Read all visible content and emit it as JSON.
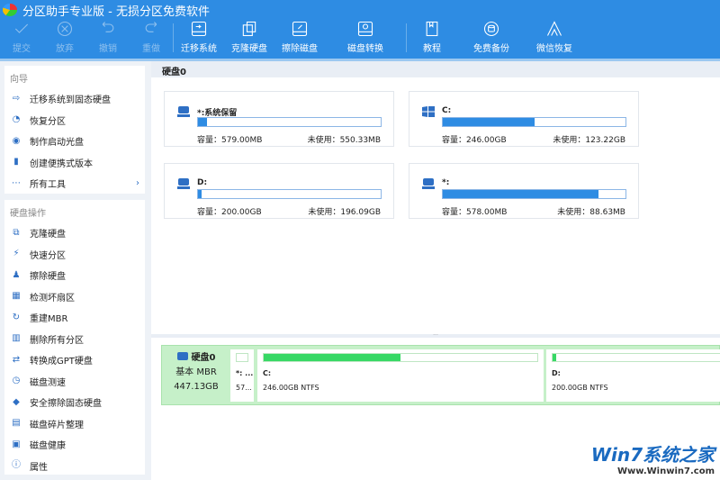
{
  "title": "分区助手专业版 - 无损分区免费软件",
  "toolbar": [
    {
      "label": "提交",
      "icon": "check-icon",
      "disabled": true
    },
    {
      "label": "放弃",
      "icon": "cancel-circle-icon",
      "disabled": true
    },
    {
      "label": "撤销",
      "icon": "undo-icon",
      "disabled": true
    },
    {
      "label": "重做",
      "icon": "redo-icon",
      "disabled": true
    },
    {
      "label": "迁移系统",
      "icon": "migrate-disk-icon"
    },
    {
      "label": "克隆硬盘",
      "icon": "clone-disk-icon"
    },
    {
      "label": "擦除磁盘",
      "icon": "wipe-disk-icon"
    },
    {
      "label": "磁盘转换",
      "icon": "convert-disk-icon"
    },
    {
      "label": "教程",
      "icon": "book-icon"
    },
    {
      "label": "免费备份",
      "icon": "backup-icon"
    },
    {
      "label": "微信恢复",
      "icon": "recover-icon"
    }
  ],
  "sidebar": {
    "wizard_title": "向导",
    "wizard": [
      {
        "label": "迁移系统到固态硬盘"
      },
      {
        "label": "恢复分区"
      },
      {
        "label": "制作启动光盘"
      },
      {
        "label": "创建便携式版本"
      },
      {
        "label": "所有工具"
      }
    ],
    "ops_title": "硬盘操作",
    "ops": [
      {
        "label": "克隆硬盘"
      },
      {
        "label": "快速分区"
      },
      {
        "label": "擦除硬盘"
      },
      {
        "label": "检测坏扇区"
      },
      {
        "label": "重建MBR"
      },
      {
        "label": "删除所有分区"
      },
      {
        "label": "转换成GPT硬盘"
      },
      {
        "label": "磁盘测速"
      },
      {
        "label": "安全擦除固态硬盘"
      },
      {
        "label": "磁盘碎片整理"
      },
      {
        "label": "磁盘健康"
      },
      {
        "label": "属性"
      }
    ]
  },
  "main": {
    "header": "硬盘0",
    "partitions": [
      {
        "name": "*:系统保留",
        "capacity": "容量：579.00MB",
        "free": "未使用：550.33MB",
        "used_pct": 5,
        "icon": "drive-icon"
      },
      {
        "name": "C:",
        "capacity": "容量：246.00GB",
        "free": "未使用：123.22GB",
        "used_pct": 50,
        "icon": "windows-icon"
      },
      {
        "name": "D:",
        "capacity": "容量：200.00GB",
        "free": "未使用：196.09GB",
        "used_pct": 2,
        "icon": "drive-icon"
      },
      {
        "name": "*:",
        "capacity": "容量：578.00MB",
        "free": "未使用：88.63MB",
        "used_pct": 85,
        "icon": "drive-icon"
      }
    ]
  },
  "diskmap": {
    "name": "硬盘0",
    "type": "基本 MBR",
    "size": "447.13GB",
    "parts": [
      {
        "label": "*: ...",
        "size": "57...",
        "used_pct": 0
      },
      {
        "label": "C:",
        "size": "246.00GB NTFS",
        "used_pct": 50
      },
      {
        "label": "D:",
        "size": "200.00GB NTFS",
        "used_pct": 2
      }
    ]
  },
  "watermark": {
    "line1": "Win7系统之家",
    "line2": "Www.Winwin7.com"
  }
}
